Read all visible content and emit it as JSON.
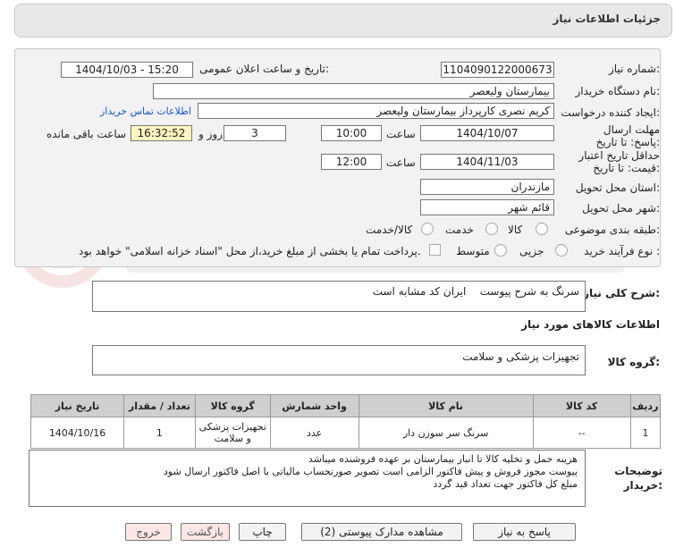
{
  "header": {
    "title": "جزئیات اطلاعات نیاز"
  },
  "form": {
    "need_number": {
      "label": "شماره نیاز:",
      "value": "1104090122000673"
    },
    "announce_datetime": {
      "label": "تاریخ و ساعت اعلان عمومی:",
      "value": "1404/10/03 - 15:20"
    },
    "buyer_org": {
      "label": "نام دستگاه خریدار:",
      "value": "بیمارستان ولیعصر"
    },
    "requester": {
      "label": "ایجاد کننده درخواست:",
      "value": "کریم نصری کارپرداز بیمارستان ولیعصر",
      "contact_link": "اطلاعات تماس خریدار"
    },
    "reply_deadline": {
      "label": "مهلت ارسال پاسخ: تا تاریخ:",
      "date": "1404/10/07",
      "time_label": "ساعت",
      "time": "10:00",
      "days": "3",
      "days_label": "روز و",
      "remaining": "16:32:52",
      "remaining_label": "ساعت باقی مانده"
    },
    "price_validity": {
      "label": "حداقل تاریخ اعتبار قیمت: تا تاریخ:",
      "date": "1404/11/03",
      "time_label": "ساعت",
      "time": "12:00"
    },
    "province": {
      "label": "استان محل تحویل:",
      "value": "مازندران"
    },
    "city": {
      "label": "شهر محل تحویل:",
      "value": "قائم شهر"
    },
    "category": {
      "label": "طبقه بندی موضوعی:",
      "options": [
        "کالا",
        "خدمت",
        "کالا/خدمت"
      ]
    },
    "process_type": {
      "label": "نوع فرآیند خرید :",
      "options": [
        "جزیی",
        "متوسط"
      ],
      "note": "پرداخت تمام یا بخشی از مبلغ خرید،از محل \"اسناد خزانه اسلامی\" خواهد بود."
    }
  },
  "general_description": {
    "label": "شرح کلی نیاز:",
    "value": "سرنگ به شرح پیوست    ایران کد مشابه است"
  },
  "goods_info_title": "اطلاعات کالاهای مورد نیاز",
  "goods_group": {
    "label": "گروه کالا:",
    "value": "تجهیزات پزشکی و سلامت"
  },
  "table": {
    "headers": [
      "ردیف",
      "کد کالا",
      "نام کالا",
      "واحد شمارش",
      "گروه کالا",
      "تعداد / مقدار",
      "تاریخ نیاز"
    ],
    "rows": [
      [
        "1",
        "--",
        "سرنگ سر سوزن دار",
        "عدد",
        "تجهیزات پزشکی و سلامت",
        "1",
        "1404/10/16"
      ]
    ]
  },
  "buyer_notes": {
    "label": "توضیحات خریدار:",
    "lines": [
      "هزینه حمل و تخلیه کالا تا انبار بیمارستان بر عهده فروشنده میباشد",
      "پیوست مجوز فروش و پیش فاکتور الزامی است  تصویر صورتحساب مالیاتی با اصل فاکتور ارسال شود",
      "مبلغ کل فاکتور جهت تعداد قید گردد"
    ]
  },
  "buttons": {
    "reply": "پاسخ به نیاز",
    "view_docs": "مشاهده مدارک پیوستی (2)",
    "print": "چاپ",
    "back": "بازگشت",
    "exit": "خروج"
  }
}
